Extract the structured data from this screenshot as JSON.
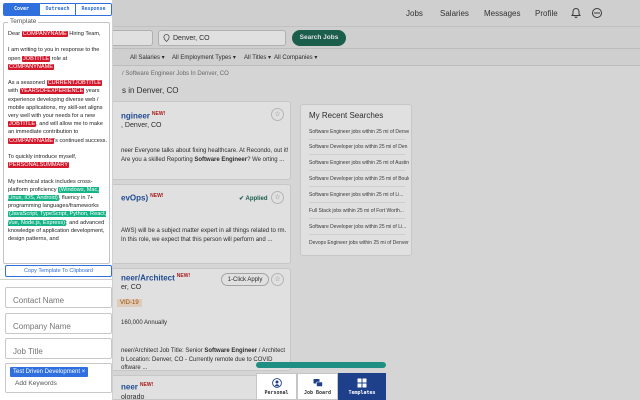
{
  "nav": {
    "links": [
      "Jobs",
      "Salaries",
      "Messages",
      "Profile"
    ]
  },
  "search": {
    "location": "Denver, CO",
    "button": "Search Jobs"
  },
  "filters": [
    "All Salaries",
    "All Employment Types",
    "All Titles",
    "All Companies"
  ],
  "breadcrumb": "Software Engineer Jobs In Denver, CO",
  "results_title": "s in Denver, CO",
  "cards": [
    {
      "title": "ngineer",
      "new": "NEW!",
      "location": "Denver, CO",
      "snippet_pre": "neer Everyone talks about fixing healthcare. At Recondo, out it! Are you a skilled Reporting ",
      "snippet_bold": "Software Engineer",
      "snippet_post": "? We orting ..."
    },
    {
      "title": "evOps)",
      "new": "NEW!",
      "status": "Applied",
      "snippet": "AWS) will be a subject matter expert in all things related to rm. In this role, we expect that this person will perform and ..."
    },
    {
      "title": "neer/Architect",
      "new": "NEW!",
      "location": "er, CO",
      "button": "1-Click Apply",
      "tag": "VID-19",
      "salary": "160,000 Annually",
      "snippet_pre": "neer/Architect Job Title: Senior ",
      "snippet_bold": "Software Engineer",
      "snippet_post": " / Architect b Location: Denver, CO - Currently remote due to COVID oftware ..."
    },
    {
      "title": "neer",
      "new": "NEW!",
      "location": "olorado"
    }
  ],
  "recent_searches": {
    "title": "My Recent Searches",
    "items": [
      "Software Engineer jobs within 25 mi of Denver",
      "Software Developer jobs within 25 mi of Den",
      "Software Engineer jobs within 25 mi of Austin",
      "Software Developer jobs within 25 mi of Bould",
      "Software Engineer jobs within 25 mi of Li...",
      "Full Stack jobs within 25 mi of Fort Worth...",
      "Software Developer jobs within 25 mi of Li...",
      "Devops Engineer jobs within 25 mi of Denver"
    ]
  },
  "bottom_nav": {
    "items": [
      {
        "label": "Personal",
        "icon": "person-icon"
      },
      {
        "label": "Job Board",
        "icon": "chat-icon"
      },
      {
        "label": "Templates",
        "icon": "grid-icon"
      }
    ],
    "active": "Templates"
  },
  "panel": {
    "tabs": [
      "Cover",
      "Outreach",
      "Response"
    ],
    "active_tab": "Cover",
    "legend": "Template",
    "copy_button": "Copy Template To Clipboard",
    "contact_placeholder": "Contact Name",
    "company_placeholder": "Company Name",
    "jobtitle_placeholder": "Job Title",
    "skill_chip": "Test Driven Development",
    "chip_close": "×",
    "add_keywords": "Add Keywords"
  },
  "letter": {
    "greeting_pre": "Dear ",
    "company": "COMPANYNAME",
    "greeting_post": " Hiring Team,",
    "p1_a": "I am writing to you in response to the open ",
    "jobtitle": "JOBTITLE",
    "p1_b": " role at ",
    "p2_a": "As a seasoned ",
    "currentjobtitle": "CURRENTJOBTITLE",
    "p2_b": " with ",
    "years": "YEARSOFEXPERIENCE",
    "p2_c": " years experience developing diverse web / mobile applications, my skill-set aligns very well with your needs for a new ",
    "p2_d": ", and will allow me to make an immediate contribution to ",
    "p2_e": "'s continued success.",
    "p3": "To quickly introduce myself,",
    "personal": "PERSONALSUMMARY",
    "p4_a": "My technical stack includes cross-platform proficiency ",
    "skill1": "(Windows, Mac, Linux, iOS, Android)",
    "p4_b": ", fluency in 7+ programming languages/frameworks ",
    "skill2": "(JavaScript, TypeScript, Python, React, Vue, Node.js, Express)",
    "p4_c": "; and advanced knowledge of application development, design patterns, and"
  },
  "colors": {
    "accent": "#2f6fde",
    "placeholder_red": "#d4182b",
    "skill_green": "#17b388",
    "nav_active": "#1e3f8a",
    "search_green": "#1f6b57"
  }
}
